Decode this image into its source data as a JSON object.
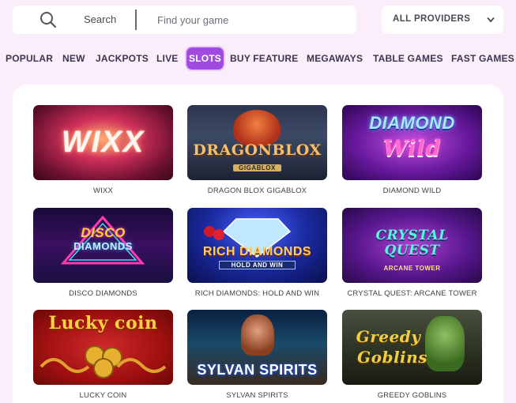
{
  "search": {
    "label": "Search",
    "placeholder": "Find your game"
  },
  "providers": {
    "selected": "ALL PROVIDERS"
  },
  "tabs": [
    {
      "label": "POPULAR"
    },
    {
      "label": "NEW"
    },
    {
      "label": "JACKPOTS"
    },
    {
      "label": "LIVE"
    },
    {
      "label": "SLOTS",
      "active": true
    },
    {
      "label": "BUY FEATURE"
    },
    {
      "label": "MEGAWAYS"
    },
    {
      "label": "TABLE GAMES"
    },
    {
      "label": "FAST GAMES"
    }
  ],
  "colors": {
    "page_bg": "#fbeefb",
    "active_tab": "#a04be0",
    "text_dark": "#3b3550"
  },
  "games": [
    {
      "name": "WIXX",
      "art_text": "WIXX"
    },
    {
      "name": "DRAGON BLOX GIGABLOX",
      "art_text": "DRAGONBLOX",
      "art_sub": "GIGABLOX"
    },
    {
      "name": "DIAMOND WILD",
      "art_text": "DIAMOND",
      "art_sub": "Wild"
    },
    {
      "name": "DISCO DIAMONDS",
      "art_text": "DISCO",
      "art_sub": "DIAMONDS"
    },
    {
      "name": "RICH DIAMONDS: HOLD AND WIN",
      "art_text": "RICH DIAMONDS",
      "art_sub": "HOLD AND WIN"
    },
    {
      "name": "CRYSTAL QUEST: ARCANE TOWER",
      "art_text": "CRYSTAL QUEST",
      "art_sub": "ARCANE TOWER"
    },
    {
      "name": "LUCKY COIN",
      "art_text": "Lucky coin"
    },
    {
      "name": "SYLVAN SPIRITS",
      "art_text": "SYLVAN SPIRITS"
    },
    {
      "name": "GREEDY GOBLINS",
      "art_text": "Greedy",
      "art_sub": "Goblins"
    }
  ]
}
